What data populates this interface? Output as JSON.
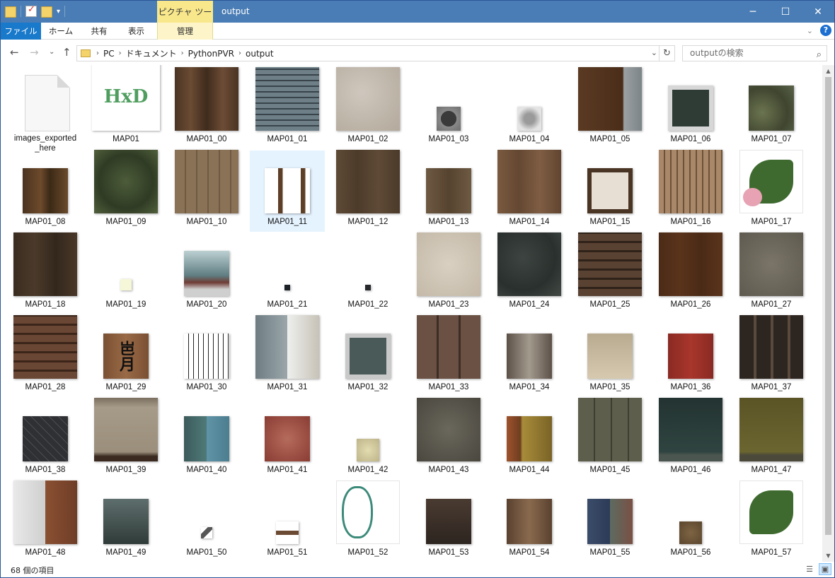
{
  "title": "output",
  "context_tab": "ピクチャ ツール",
  "ribbon": {
    "tabs": [
      "ファイル",
      "ホーム",
      "共有",
      "表示"
    ],
    "manage_label": "管理"
  },
  "breadcrumb": [
    "PC",
    "ドキュメント",
    "PythonPVR",
    "output"
  ],
  "search_placeholder": "outputの検索",
  "status": "68 個の項目",
  "colors": {
    "titlebar": "#4a7db5",
    "file_tab": "#1979ca",
    "context_tab": "#f9e88b",
    "selection": "#e5f3ff"
  },
  "items": [
    {
      "name": "images_exported_here",
      "kind": "doc"
    },
    {
      "name": "MAP01",
      "kind": "image",
      "size": 96,
      "bg": "#ffffff",
      "fg": "#4f9e5f",
      "text": "HxD"
    },
    {
      "name": "MAP01_00",
      "kind": "image",
      "size": 90,
      "bg": "linear-gradient(90deg,#4a3424,#6b4b33,#3f2b1c,#6d4c35,#4a3424)"
    },
    {
      "name": "MAP01_01",
      "kind": "image",
      "size": 90,
      "bg": "repeating-linear-gradient(0deg,#6e7f88 0px,#6e7f88 6px,#38434a 6px,#38434a 8px)"
    },
    {
      "name": "MAP01_02",
      "kind": "image",
      "size": 90,
      "bg": "radial-gradient(circle at 40% 40%,#cfc7bd,#b3a99c)"
    },
    {
      "name": "MAP01_03",
      "kind": "image",
      "size": 34,
      "bg": "radial-gradient(circle,#3a3a3a 45%,#8a8a8a 47%,#6e6e6e)"
    },
    {
      "name": "MAP01_04",
      "kind": "image",
      "size": 34,
      "bg": "radial-gradient(circle,#9a9a9a 30%,#e4e4e4 70%)"
    },
    {
      "name": "MAP01_05",
      "kind": "image",
      "size": 90,
      "bg": "linear-gradient(90deg,#5b3a22 0%,#4a2d19 70%,#9aa0a3 72%,#7d8487 100%)"
    },
    {
      "name": "MAP01_06",
      "kind": "image",
      "size": 64,
      "bg": "linear-gradient(#d7d7d7,#d7d7d7)",
      "inner": "#2f3c36"
    },
    {
      "name": "MAP01_07",
      "kind": "image",
      "size": 64,
      "bg": "radial-gradient(circle at 30% 60%,#6b7450,#3f452f 60%,#5b634a)"
    },
    {
      "name": "MAP01_08",
      "kind": "image",
      "size": 64,
      "bg": "linear-gradient(90deg,#4a3320,#6d4a2b 40%,#3b2916 60%,#6a4a2c)"
    },
    {
      "name": "MAP01_09",
      "kind": "image",
      "size": 90,
      "bg": "radial-gradient(circle at 50% 50%,#4d5c3a,#2f3b24 60%,#51603c)"
    },
    {
      "name": "MAP01_10",
      "kind": "image",
      "size": 90,
      "bg": "repeating-linear-gradient(90deg,#8a7257 0,#8a7257 14px,#6f5941 14px,#6f5941 16px)"
    },
    {
      "name": "MAP01_11",
      "kind": "image",
      "size": 64,
      "bg": "linear-gradient(90deg,#fff 0,#fff 30%,#5d3f27 30%,#5d3f27 40%,#fff 40%,#fff 80%,#5d3f27 80%,#5d3f27 90%,#fff 90%)",
      "selected": true
    },
    {
      "name": "MAP01_12",
      "kind": "image",
      "size": 90,
      "bg": "linear-gradient(90deg,#5e4a36,#4d3b2a,#5e4a36,#4c3a29)"
    },
    {
      "name": "MAP01_13",
      "kind": "image",
      "size": 64,
      "bg": "linear-gradient(90deg,#6e5a43,#56432f,#6e5a43)"
    },
    {
      "name": "MAP01_14",
      "kind": "image",
      "size": 90,
      "bg": "linear-gradient(90deg,#7a5a40,#654832,#7e5d43,#624530)"
    },
    {
      "name": "MAP01_15",
      "kind": "image",
      "size": 64,
      "bg": "linear-gradient(#e8dfd4,#e8dfd4)",
      "frame": "#4a3424"
    },
    {
      "name": "MAP01_16",
      "kind": "image",
      "size": 90,
      "bg": "repeating-linear-gradient(90deg,#a9886a 0,#a9886a 7px,#6d5238 7px,#6d5238 9px)"
    },
    {
      "name": "MAP01_17",
      "kind": "image",
      "size": 90,
      "bg": "linear-gradient(#ffffff,#ffffff)",
      "plant": true
    },
    {
      "name": "MAP01_18",
      "kind": "image",
      "size": 90,
      "bg": "linear-gradient(90deg,#3a2c20,#4b3a2a,#33271c,#4a3829)"
    },
    {
      "name": "MAP01_19",
      "kind": "image",
      "size": 16,
      "bg": "linear-gradient(#f6f7d8,#f6f7d8)"
    },
    {
      "name": "MAP01_20",
      "kind": "image",
      "size": 64,
      "bg": "linear-gradient(#bcd0d2,#5f7d82 55%,#6f3b34 70%,#cfcfcf 85%)"
    },
    {
      "name": "MAP01_21",
      "kind": "image",
      "size": 8,
      "bg": "linear-gradient(#1b2127,#1b2127)"
    },
    {
      "name": "MAP01_22",
      "kind": "image",
      "size": 8,
      "bg": "linear-gradient(#26282b,#26282b)"
    },
    {
      "name": "MAP01_23",
      "kind": "image",
      "size": 90,
      "bg": "radial-gradient(circle,#d9d0c2,#c4b9a8)"
    },
    {
      "name": "MAP01_24",
      "kind": "image",
      "size": 90,
      "bg": "radial-gradient(circle at 40% 40%,#3d4441,#2a302d 60%,#424a46)"
    },
    {
      "name": "MAP01_25",
      "kind": "image",
      "size": 90,
      "bg": "repeating-linear-gradient(0deg,#5a4232 0,#5a4232 10px,#2f2219 10px,#2f2219 13px)"
    },
    {
      "name": "MAP01_26",
      "kind": "image",
      "size": 90,
      "bg": "linear-gradient(90deg,#4b2b17,#5a331b,#4a2a16,#5b341c)"
    },
    {
      "name": "MAP01_27",
      "kind": "image",
      "size": 90,
      "bg": "radial-gradient(circle,#7a7568,#5f5a4f)"
    },
    {
      "name": "MAP01_28",
      "kind": "image",
      "size": 90,
      "bg": "repeating-linear-gradient(0deg,#6a4634 0,#6a4634 10px,#3b2519 10px,#3b2519 13px)"
    },
    {
      "name": "MAP01_29",
      "kind": "image",
      "size": 64,
      "bg": "linear-gradient(90deg,#7a5033,#9a6a46,#7a5033)",
      "fg": "#111",
      "text": "岜月"
    },
    {
      "name": "MAP01_30",
      "kind": "image",
      "size": 64,
      "bg": "repeating-linear-gradient(90deg,#fff 0,#fff 6px,#222 6px,#222 7px)"
    },
    {
      "name": "MAP01_31",
      "kind": "image",
      "size": 90,
      "bg": "linear-gradient(90deg,#6f7d83 0,#9aa6aa 50%,#eef0ee 50%,#c7c2b7 100%)"
    },
    {
      "name": "MAP01_32",
      "kind": "image",
      "size": 64,
      "bg": "linear-gradient(#c9c9c9,#c9c9c9)",
      "inner": "#4a5a59"
    },
    {
      "name": "MAP01_33",
      "kind": "image",
      "size": 90,
      "bg": "repeating-linear-gradient(90deg,#6a5144 0,#6a5144 28px,#3d2d25 28px,#3d2d25 31px)"
    },
    {
      "name": "MAP01_34",
      "kind": "image",
      "size": 64,
      "bg": "linear-gradient(90deg,#5c5147,#a39a8e,#5c5147)"
    },
    {
      "name": "MAP01_35",
      "kind": "image",
      "size": 64,
      "bg": "linear-gradient(#b9ab90,#d6c9b0)"
    },
    {
      "name": "MAP01_36",
      "kind": "image",
      "size": 64,
      "bg": "linear-gradient(90deg,#8a2a23,#a8362c,#8a2a23)"
    },
    {
      "name": "MAP01_37",
      "kind": "image",
      "size": 90,
      "bg": "repeating-linear-gradient(90deg,#2d2520 0,#2d2520 20px,#5a4a3e 20px,#5a4a3e 24px)"
    },
    {
      "name": "MAP01_38",
      "kind": "image",
      "size": 64,
      "bg": "repeating-linear-gradient(45deg,#2f3033 0,#2f3033 8px,#4a4c50 8px,#4a4c50 9px)"
    },
    {
      "name": "MAP01_39",
      "kind": "image",
      "size": 90,
      "bg": "linear-gradient(#7b6f60 0,#a69a88 15%,#9b8f7c 85%,#3a2a20 92%)"
    },
    {
      "name": "MAP01_40",
      "kind": "image",
      "size": 64,
      "bg": "linear-gradient(90deg,#3d5a5b 0,#4e7a78 50%,#5f94a6 50%,#4c7d90 100%)"
    },
    {
      "name": "MAP01_41",
      "kind": "image",
      "size": 64,
      "bg": "radial-gradient(circle,#b56b5c,#8a3c33)"
    },
    {
      "name": "MAP01_42",
      "kind": "image",
      "size": 32,
      "bg": "radial-gradient(circle,#e3dcb1,#bdb488)"
    },
    {
      "name": "MAP01_43",
      "kind": "image",
      "size": 90,
      "bg": "radial-gradient(circle,#6a675c,#4a473f)"
    },
    {
      "name": "MAP01_44",
      "kind": "image",
      "size": 64,
      "bg": "linear-gradient(90deg,#a0522d 0,#6d3e1f 30%,#a88c3a 35%,#7a6326 100%)"
    },
    {
      "name": "MAP01_45",
      "kind": "image",
      "size": 90,
      "bg": "repeating-linear-gradient(90deg,#5e5e4c 0,#5e5e4c 22px,#3d3d31 22px,#3d3d31 24px)"
    },
    {
      "name": "MAP01_46",
      "kind": "image",
      "size": 90,
      "bg": "linear-gradient(#233331,#2f4440 85%,#4c5650 90%)"
    },
    {
      "name": "MAP01_47",
      "kind": "image",
      "size": 90,
      "bg": "linear-gradient(#5a5426,#6b6530 85%,#4b4a3a 90%)"
    },
    {
      "name": "MAP01_48",
      "kind": "image",
      "size": 90,
      "bg": "linear-gradient(90deg,#e9e9e9 0,#cfcfcf 50%,#8a5032 50%,#6f3d27 100%)"
    },
    {
      "name": "MAP01_49",
      "kind": "image",
      "size": 64,
      "bg": "linear-gradient(#5e6e6c,#2f3b39)"
    },
    {
      "name": "MAP01_50",
      "kind": "image",
      "size": 16,
      "bg": "linear-gradient(135deg,#fff 30%,#555 30%,#555 60%,#fff 60%)"
    },
    {
      "name": "MAP01_51",
      "kind": "image",
      "size": 32,
      "bg": "linear-gradient(#fff 40%,#6b4a33 40%,#6b4a33 60%,#fff 60%)"
    },
    {
      "name": "MAP01_52",
      "kind": "image",
      "size": 90,
      "bg": "linear-gradient(#ffffff,#ffffff)",
      "hose": true
    },
    {
      "name": "MAP01_53",
      "kind": "image",
      "size": 64,
      "bg": "linear-gradient(#4a3b31,#2d2520)"
    },
    {
      "name": "MAP01_54",
      "kind": "image",
      "size": 64,
      "bg": "linear-gradient(90deg,#5a4230,#8a6a4e,#5a4230)"
    },
    {
      "name": "MAP01_55",
      "kind": "image",
      "size": 64,
      "bg": "linear-gradient(90deg,#3b4c6a 0,#2c3b57 50%,#5d6b60 50%,#7a5044 100%)"
    },
    {
      "name": "MAP01_56",
      "kind": "image",
      "size": 32,
      "bg": "radial-gradient(circle,#7e6443,#5a462e)"
    },
    {
      "name": "MAP01_57",
      "kind": "image",
      "size": 90,
      "bg": "linear-gradient(#ffffff,#ffffff)",
      "plant2": true
    }
  ]
}
